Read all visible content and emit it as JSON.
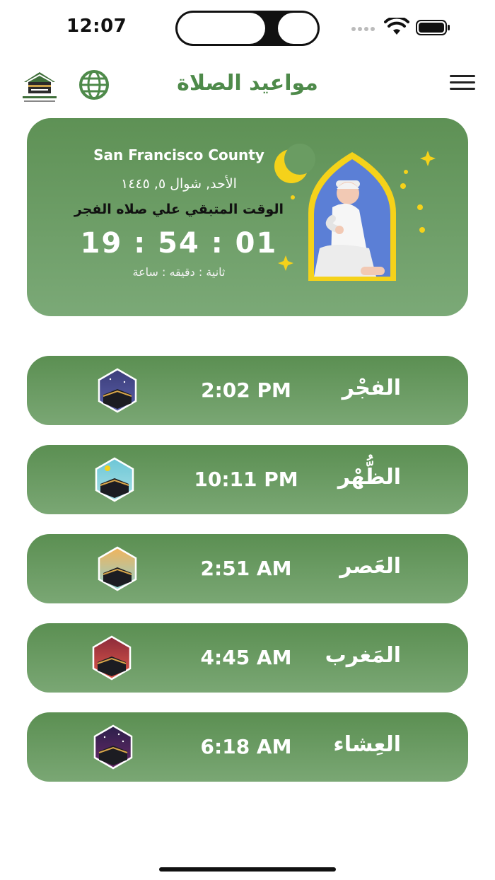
{
  "status_bar": {
    "time": "12:07"
  },
  "header": {
    "title": "مواعيد الصلاة"
  },
  "hero": {
    "location": "San Francisco County",
    "hijri_date": "الأحد, شوال ٥, ١٤٤٥",
    "remaining_label": "الوقت المتبقي علي صلاه الفجر",
    "countdown": "19 : 54 : 01",
    "units_label": "ثانية : دقيقه : ساعة"
  },
  "prayers": [
    {
      "name": "الفجْر",
      "time": "2:02 PM",
      "icon": "fajr-kaaba-icon",
      "sky": [
        "#3b3d7a",
        "#5a5fa8"
      ]
    },
    {
      "name": "الظُّهْر",
      "time": "10:11 PM",
      "icon": "dhuhr-kaaba-icon",
      "sky": [
        "#6cc6d6",
        "#a8e0e6"
      ]
    },
    {
      "name": "العَصر",
      "time": "2:51 AM",
      "icon": "asr-kaaba-icon",
      "sky": [
        "#f2b35a",
        "#8fd0d0"
      ]
    },
    {
      "name": "المَغرب",
      "time": "4:45 AM",
      "icon": "maghrib-kaaba-icon",
      "sky": [
        "#8b2a3a",
        "#e05a4a"
      ]
    },
    {
      "name": "العِشاء",
      "time": "6:18 AM",
      "icon": "isha-kaaba-icon",
      "sky": [
        "#2b1f4a",
        "#6a2a6a"
      ]
    }
  ],
  "colors": {
    "accent": "#4e8a4a",
    "card_top": "#5e9155",
    "card_bottom": "#7ba977"
  }
}
